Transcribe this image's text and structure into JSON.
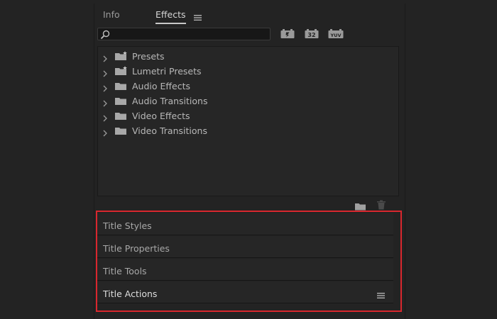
{
  "tabs": {
    "info_label": "Info",
    "effects_label": "Effects"
  },
  "search": {
    "value": "",
    "placeholder": ""
  },
  "toolbar": {
    "accelerated_icon": "accelerated-effects-icon",
    "bit32_label": "32",
    "yuv_label": "YUV"
  },
  "tree": {
    "items": [
      {
        "label": "Presets",
        "icon": "folder-star-icon"
      },
      {
        "label": "Lumetri Presets",
        "icon": "folder-star-icon"
      },
      {
        "label": "Audio Effects",
        "icon": "folder-icon"
      },
      {
        "label": "Audio Transitions",
        "icon": "folder-icon"
      },
      {
        "label": "Video Effects",
        "icon": "folder-icon"
      },
      {
        "label": "Video Transitions",
        "icon": "folder-icon"
      }
    ]
  },
  "titles": {
    "items": [
      {
        "label": "Title Styles"
      },
      {
        "label": "Title Properties"
      },
      {
        "label": "Title Tools"
      },
      {
        "label": "Title Actions"
      }
    ]
  },
  "colors": {
    "background": "#232323",
    "highlight_border": "#d9272e",
    "active_tab_underline": "#c8c8c8"
  }
}
